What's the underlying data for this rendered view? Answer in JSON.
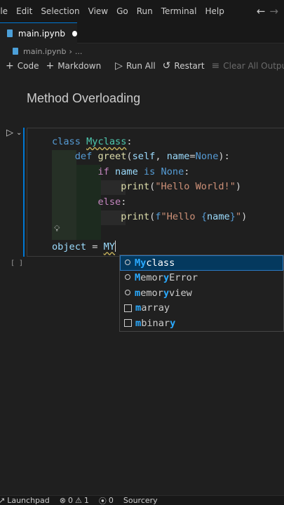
{
  "menu": [
    "ile",
    "Edit",
    "Selection",
    "View",
    "Go",
    "Run",
    "Terminal",
    "Help"
  ],
  "nav": {
    "back": "←",
    "forward": "→"
  },
  "tab": {
    "label": "main.ipynb"
  },
  "breadcrumb": {
    "file": "main.ipynb",
    "rest": "..."
  },
  "toolbar": {
    "code": "Code",
    "markdown": "Markdown",
    "run_all": "Run All",
    "restart": "Restart",
    "clear_all": "Clear All Outputs"
  },
  "markdown_cell": {
    "heading": "Method Overloading"
  },
  "code_cell": {
    "execution_count": "[ ]",
    "lines": {
      "l1_kw": "class",
      "l1_name": "Myclass",
      "l1_colon": ":",
      "l2_kw": "def",
      "l2_fn": "greet",
      "l2_open": "(",
      "l2_self": "self",
      "l2_comma": ", ",
      "l2_param": "name",
      "l2_eq": "=",
      "l2_none": "None",
      "l2_close": "):",
      "l3_kw": "if",
      "l3_name": "name",
      "l3_is": "is",
      "l3_none": "None",
      "l3_colon": ":",
      "l4_fn": "print",
      "l4_str": "\"Hello World!\"",
      "l5_kw": "else",
      "l5_colon": ":",
      "l6_fn": "print",
      "l6_prefix": "f",
      "l6_str_a": "\"Hello ",
      "l6_lbrace": "{",
      "l6_var": "name",
      "l6_rbrace": "}",
      "l6_str_b": "\"",
      "l7_var": "object",
      "l7_eq": " = ",
      "l7_typed": "MY"
    }
  },
  "suggestions": [
    {
      "icon": "class-icon",
      "match": "My",
      "rest": "class",
      "selected": true
    },
    {
      "icon": "class-icon",
      "match": "M",
      "mid": "emor",
      "match2": "y",
      "rest": "Error",
      "selected": false
    },
    {
      "icon": "class-icon",
      "match": "m",
      "mid": "emor",
      "match2": "y",
      "rest": "view",
      "selected": false
    },
    {
      "icon": "text-icon",
      "match": "m",
      "rest": "array",
      "selected": false
    },
    {
      "icon": "text-icon",
      "match": "m",
      "mid": "binar",
      "match2": "y",
      "rest": "",
      "selected": false
    }
  ],
  "status": {
    "launchpad": "Launchpad",
    "errors": "0",
    "warnings": "1",
    "ports": "0",
    "sourcery": "Sourcery"
  },
  "colors": {
    "accent": "#0078d4",
    "background": "#1f1f1f",
    "suggest_selected": "#04395e"
  }
}
